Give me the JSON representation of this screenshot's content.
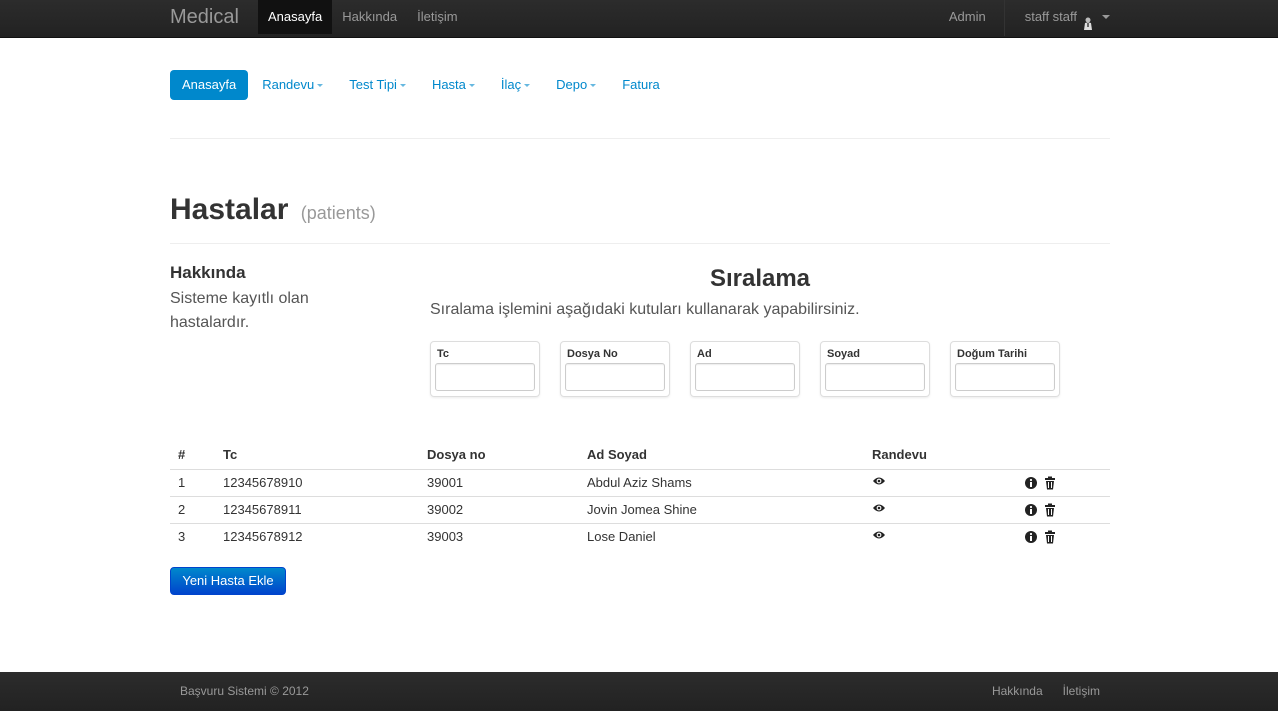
{
  "navbar": {
    "brand": "Medical",
    "links": [
      "Anasayfa",
      "Hakkında",
      "İletişim"
    ],
    "admin": "Admin",
    "user": "staff staff"
  },
  "subnav": [
    {
      "label": "Anasayfa",
      "dropdown": false
    },
    {
      "label": "Randevu",
      "dropdown": true
    },
    {
      "label": "Test Tipi",
      "dropdown": true
    },
    {
      "label": "Hasta",
      "dropdown": true
    },
    {
      "label": "İlaç",
      "dropdown": true
    },
    {
      "label": "Depo",
      "dropdown": true
    },
    {
      "label": "Fatura",
      "dropdown": false
    }
  ],
  "page": {
    "title": "Hastalar",
    "subtitle": "(patients)"
  },
  "about": {
    "title": "Hakkında",
    "text": "Sisteme kayıtlı olan hastalardır."
  },
  "sort": {
    "title": "Sıralama",
    "description": "Sıralama işlemini aşağıdaki kutuları kullanarak yapabilirsiniz.",
    "fields": [
      {
        "label": "Tc",
        "value": ""
      },
      {
        "label": "Dosya No",
        "value": ""
      },
      {
        "label": "Ad",
        "value": ""
      },
      {
        "label": "Soyad",
        "value": ""
      },
      {
        "label": "Doğum Tarihi",
        "value": ""
      }
    ]
  },
  "table": {
    "headers": [
      "#",
      "Tc",
      "Dosya no",
      "Ad Soyad",
      "Randevu",
      ""
    ],
    "rows": [
      {
        "num": "1",
        "tc": "12345678910",
        "dosya": "39001",
        "name": "Abdul Aziz Shams"
      },
      {
        "num": "2",
        "tc": "12345678911",
        "dosya": "39002",
        "name": "Jovin Jomea Shine"
      },
      {
        "num": "3",
        "tc": "12345678912",
        "dosya": "39003",
        "name": "Lose Daniel"
      }
    ]
  },
  "add_button": "Yeni Hasta Ekle",
  "footer": {
    "copyright": "Başvuru Sistemi © 2012",
    "links": [
      "Hakkında",
      "İletişim"
    ]
  },
  "icons": {
    "view": "eye-icon",
    "info": "info-icon",
    "delete": "trash-icon",
    "user": "person-icon"
  },
  "colors": {
    "accent": "#0088cc",
    "navbar": "#222222"
  }
}
